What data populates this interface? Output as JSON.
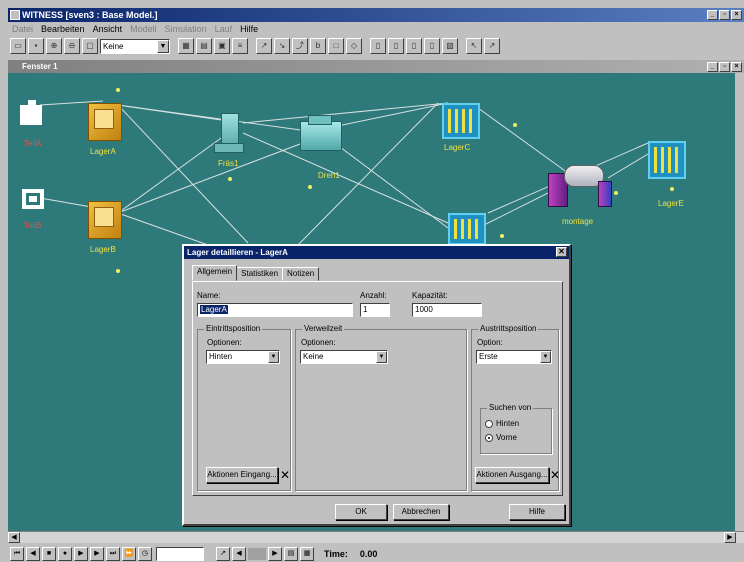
{
  "app": {
    "title": "WITNESS [sven3 : Base Model.]",
    "menu": [
      "Datei",
      "Bearbeiten",
      "Ansicht",
      "Modell",
      "Simulation",
      "Lauf",
      "Hilfe"
    ],
    "menu_disabled": [
      true,
      false,
      false,
      true,
      true,
      true,
      false
    ],
    "toolbar_combo_value": "Keine"
  },
  "child_window": {
    "title": "Fenster 1"
  },
  "model": {
    "elements": {
      "teila": "TeilA",
      "teilb": "TeilB",
      "lagera": "LagerA",
      "lagerb": "LagerB",
      "fraes": "Fräs1",
      "dreh": "Dreh1",
      "lagerc": "LagerC",
      "lagerd": "LagerD",
      "lagere": "LagerE",
      "montage": "montage"
    },
    "colors": {
      "background": "#2e7a7a",
      "label": "#f0e040",
      "part_label": "#e05050"
    }
  },
  "dialog": {
    "title": "Lager detaillieren - LagerA",
    "close_label": "✕",
    "tabs": [
      "Allgemein",
      "Statistiken",
      "Notizen"
    ],
    "name_label": "Name:",
    "name_value": "LagerA",
    "anzahl_label": "Anzahl:",
    "anzahl_value": "1",
    "kapazitaet_label": "Kapazität:",
    "kapazitaet_value": "1000",
    "eintritt": {
      "title": "Eintrittsposition",
      "optionen_label": "Optionen:",
      "optionen_value": "Hinten",
      "action_button": "Aktionen Eingang..."
    },
    "verweilzeit": {
      "title": "Verweilzeit",
      "optionen_label": "Optionen:",
      "optionen_value": "Keine"
    },
    "austritt": {
      "title": "Austrittsposition",
      "option_label": "Option:",
      "option_value": "Erste",
      "suchen_title": "Suchen von",
      "radio_hinten": "Hinten",
      "radio_vorne": "Vorne",
      "selected": "Vorne",
      "action_button": "Aktionen Ausgang..."
    },
    "buttons": {
      "ok": "OK",
      "cancel": "Abbrechen",
      "help": "Hilfe"
    }
  },
  "statusbar": {
    "time_label": "Time:",
    "time_value": "0.00"
  }
}
